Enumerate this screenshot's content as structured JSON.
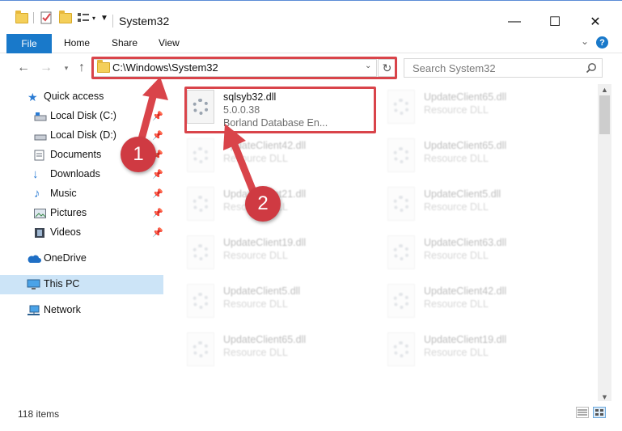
{
  "window": {
    "title": "System32",
    "minimize_glyph": "—",
    "maximize_glyph": "☐",
    "close_glyph": "✕"
  },
  "ribbon": {
    "file": "File",
    "home": "Home",
    "share": "Share",
    "view": "View",
    "help_glyph": "?"
  },
  "address": {
    "path": "C:\\Windows\\System32",
    "search_placeholder": "Search System32"
  },
  "nav": {
    "items": [
      {
        "label": "Quick access",
        "icon": "star-icon"
      },
      {
        "label": "Local Disk (C:)",
        "icon": "drive-icon"
      },
      {
        "label": "Local Disk (D:)",
        "icon": "drive-icon"
      },
      {
        "label": "Documents",
        "icon": "documents-icon"
      },
      {
        "label": "Downloads",
        "icon": "download-arrow-icon"
      },
      {
        "label": "Music",
        "icon": "music-note-icon"
      },
      {
        "label": "Pictures",
        "icon": "pictures-icon"
      },
      {
        "label": "Videos",
        "icon": "film-icon"
      },
      {
        "label": "OneDrive",
        "icon": "cloud-icon"
      },
      {
        "label": "This PC",
        "icon": "monitor-icon"
      },
      {
        "label": "Network",
        "icon": "network-icon"
      }
    ]
  },
  "files": {
    "selected": {
      "name": "sqlsyb32.dll",
      "version": "5.0.0.38",
      "description": "Borland Database En..."
    },
    "left_column": [
      {
        "name": "UpdateClient42.dll",
        "description": "Resource DLL"
      },
      {
        "name": "UpdateClient21.dll",
        "description": "Resource DLL"
      },
      {
        "name": "UpdateClient19.dll",
        "description": "Resource DLL"
      },
      {
        "name": "UpdateClient5.dll",
        "description": "Resource DLL"
      },
      {
        "name": "UpdateClient65.dll",
        "description": "Resource DLL"
      }
    ],
    "right_column": [
      {
        "name": "UpdateClient65.dll",
        "description": "Resource DLL"
      },
      {
        "name": "UpdateClient65.dll",
        "description": "Resource DLL"
      },
      {
        "name": "UpdateClient5.dll",
        "description": "Resource DLL"
      },
      {
        "name": "UpdateClient63.dll",
        "description": "Resource DLL"
      },
      {
        "name": "UpdateClient42.dll",
        "description": "Resource DLL"
      },
      {
        "name": "UpdateClient19.dll",
        "description": "Resource DLL"
      }
    ]
  },
  "status": {
    "item_count": "118 items"
  },
  "annotations": {
    "step1": "1",
    "step2": "2",
    "color": "#d9444a"
  },
  "colors": {
    "accent": "#1979ca",
    "selection": "#cce4f7",
    "annotation_red": "#d9444a"
  }
}
